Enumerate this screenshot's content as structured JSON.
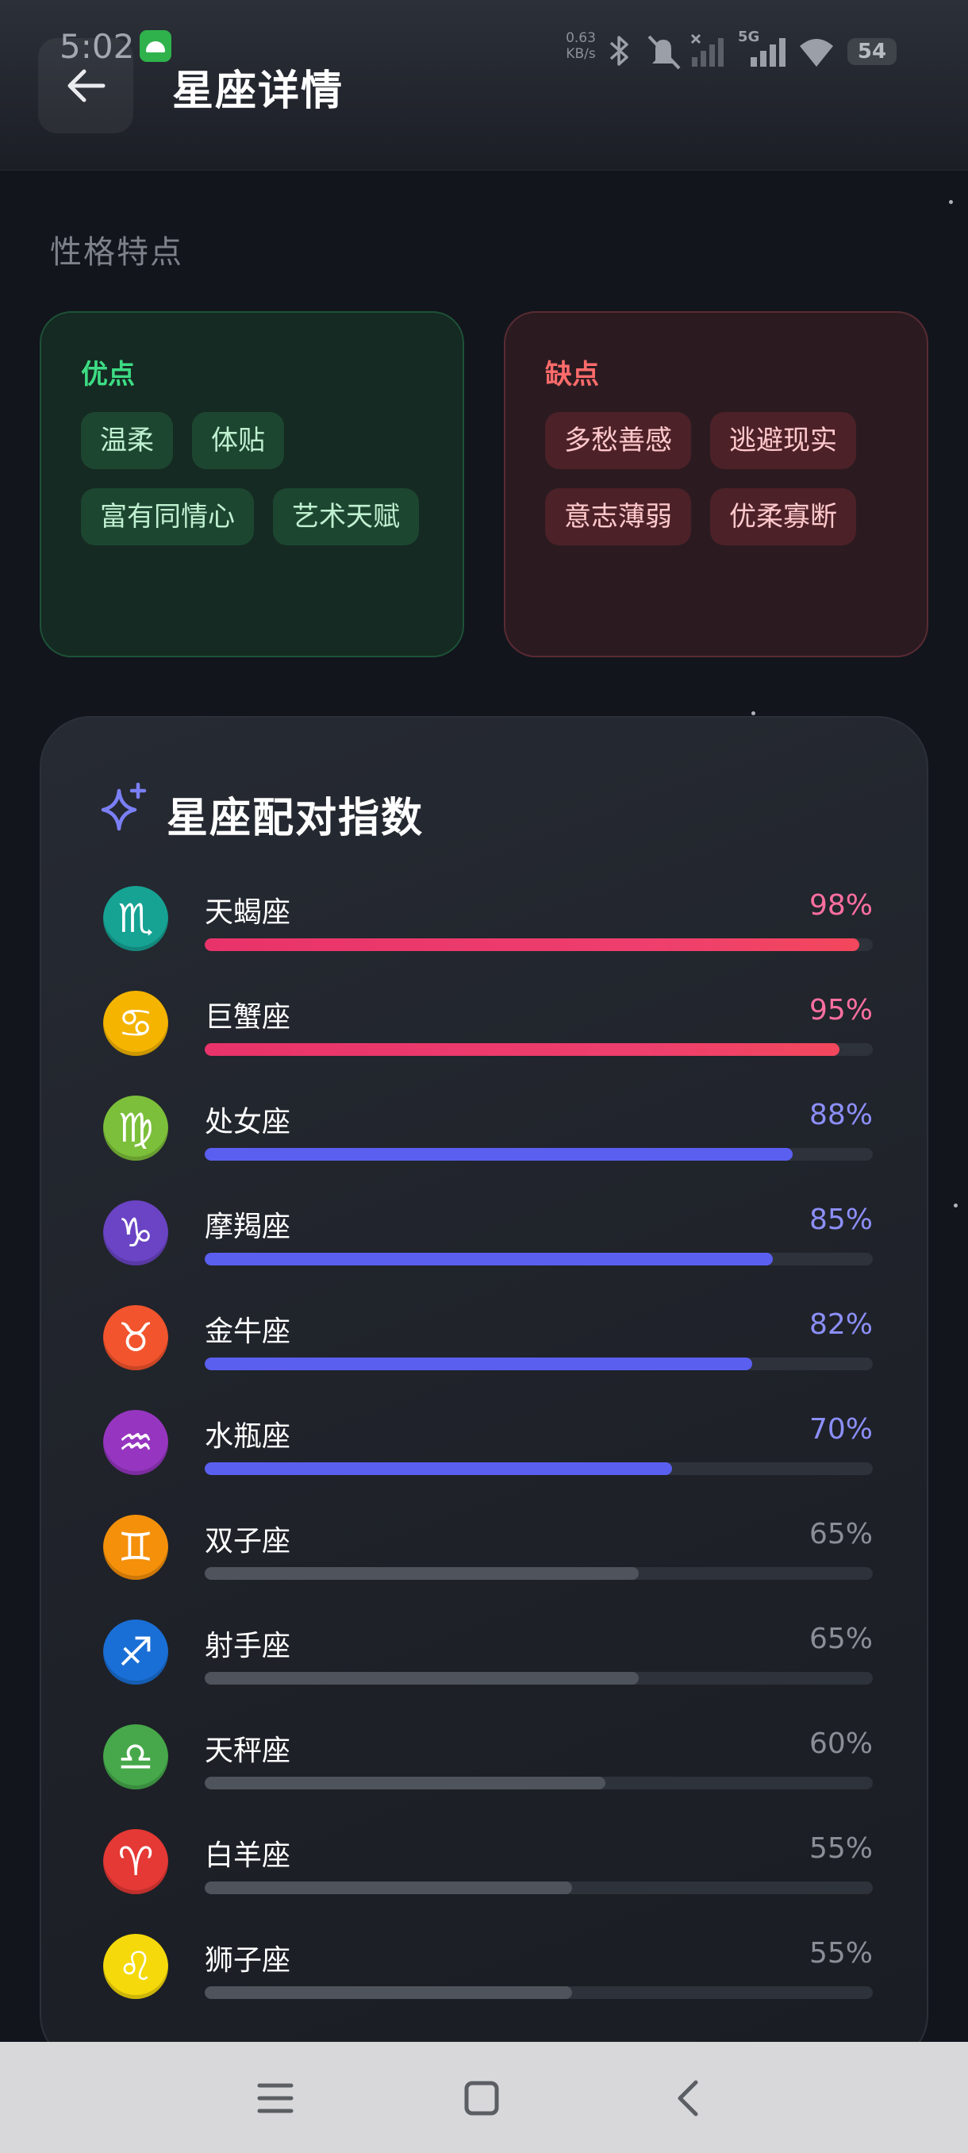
{
  "status_bar": {
    "time": "5:02",
    "net_speed_value": "0.63",
    "net_speed_unit": "KB/s",
    "network_gen": "5G",
    "battery": "54"
  },
  "header": {
    "title": "星座详情"
  },
  "personality": {
    "section_title": "性格特点",
    "pros": {
      "label": "优点",
      "tags": [
        "温柔",
        "体贴",
        "富有同情心",
        "艺术天赋"
      ]
    },
    "cons": {
      "label": "缺点",
      "tags": [
        "多愁善感",
        "逃避现实",
        "意志薄弱",
        "优柔寡断"
      ]
    }
  },
  "compatibility": {
    "title": "星座配对指数",
    "items": [
      {
        "name": "天蝎座",
        "percent_text": "98%",
        "value": 98,
        "tier": "high",
        "symbol": "♏",
        "icon": "scorpio-icon",
        "icon_color": "#16a394"
      },
      {
        "name": "巨蟹座",
        "percent_text": "95%",
        "value": 95,
        "tier": "high",
        "symbol": "♋",
        "icon": "cancer-icon",
        "icon_color": "#f5b400"
      },
      {
        "name": "处女座",
        "percent_text": "88%",
        "value": 88,
        "tier": "mid",
        "symbol": "♍",
        "icon": "virgo-icon",
        "icon_color": "#7cbf3a"
      },
      {
        "name": "摩羯座",
        "percent_text": "85%",
        "value": 85,
        "tier": "mid",
        "symbol": "♑",
        "icon": "capricorn-icon",
        "icon_color": "#6a44c4"
      },
      {
        "name": "金牛座",
        "percent_text": "82%",
        "value": 82,
        "tier": "mid",
        "symbol": "♉",
        "icon": "taurus-icon",
        "icon_color": "#f2542d"
      },
      {
        "name": "水瓶座",
        "percent_text": "70%",
        "value": 70,
        "tier": "mid",
        "symbol": "♒",
        "icon": "aquarius-icon",
        "icon_color": "#9636c0"
      },
      {
        "name": "双子座",
        "percent_text": "65%",
        "value": 65,
        "tier": "low",
        "symbol": "♊",
        "icon": "gemini-icon",
        "icon_color": "#f5900a"
      },
      {
        "name": "射手座",
        "percent_text": "65%",
        "value": 65,
        "tier": "low",
        "symbol": "♐",
        "icon": "sagittarius-icon",
        "icon_color": "#1a6fd6"
      },
      {
        "name": "天秤座",
        "percent_text": "60%",
        "value": 60,
        "tier": "low",
        "symbol": "♎",
        "icon": "libra-icon",
        "icon_color": "#46a84a"
      },
      {
        "name": "白羊座",
        "percent_text": "55%",
        "value": 55,
        "tier": "low",
        "symbol": "♈",
        "icon": "aries-icon",
        "icon_color": "#e53935"
      },
      {
        "name": "狮子座",
        "percent_text": "55%",
        "value": 55,
        "tier": "low",
        "symbol": "♌",
        "icon": "leo-icon",
        "icon_color": "#f5d90a"
      }
    ]
  },
  "colors": {
    "background": "#12151c",
    "high_bar": "#ee3f6d",
    "high_text": "#ff6fa0",
    "mid_bar": "#5b5ff0",
    "mid_text": "#8c8ff8",
    "low_bar": "#4f535b",
    "low_text": "#8a8e96",
    "pros_accent": "#3ddc84",
    "cons_accent": "#ff6b6b"
  },
  "nav_bar": {
    "icons": [
      "menu-icon",
      "home-icon",
      "back-icon"
    ]
  }
}
